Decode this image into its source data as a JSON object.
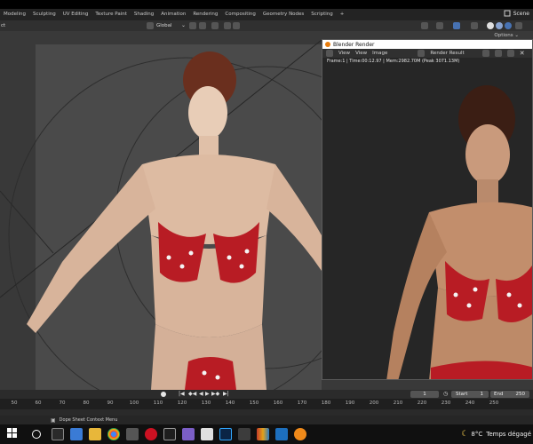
{
  "workspace_tabs": [
    "Modeling",
    "Sculpting",
    "UV Editing",
    "Texture Paint",
    "Shading",
    "Animation",
    "Rendering",
    "Compositing",
    "Geometry Nodes",
    "Scripting"
  ],
  "add_tab_label": "+",
  "scene_label": "Scene",
  "header": {
    "left_fragment": "ct",
    "orientation_value": "Global",
    "options_label": "Options"
  },
  "render_window": {
    "title": "Blender Render",
    "menu": [
      "View",
      "View",
      "Image"
    ],
    "slot_label": "Render Result",
    "info": "Frame:1 | Time:00:12.97 | Mem:2982.70M (Peak 3071.13M)"
  },
  "timeline": {
    "current_frame": "1",
    "start_label": "Start",
    "start_value": "1",
    "end_label": "End",
    "end_value": "250",
    "ticks": [
      "50",
      "60",
      "70",
      "80",
      "90",
      "100",
      "110",
      "120",
      "130",
      "140",
      "150",
      "160",
      "170",
      "180",
      "190",
      "200",
      "210",
      "220",
      "230",
      "240",
      "250"
    ]
  },
  "status": {
    "hint": "Dope Sheet Context Menu"
  },
  "taskbar": {
    "weather": "8°C",
    "weather_text": "Temps dégagé"
  },
  "colors": {
    "accent": "#4772b3",
    "active_frame": "#4772b3",
    "bikini_red": "#b81c24"
  }
}
